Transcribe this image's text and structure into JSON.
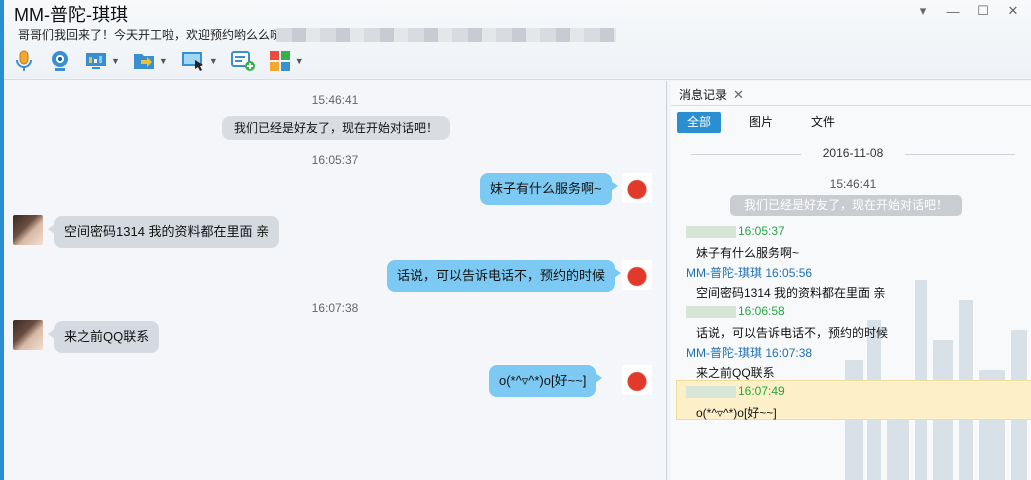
{
  "window": {
    "title": "MM-普陀-琪琪",
    "signature": "哥哥们我回来了！今天开工啦，欢迎预约哟么么哒",
    "controls": {
      "dropdown_icon": "chevron-down-icon",
      "minimize_icon": "minimize-icon",
      "maximize_icon": "maximize-icon",
      "close_icon": "close-icon"
    }
  },
  "toolbar": {
    "items": [
      {
        "name": "voice-call",
        "icon": "microphone-icon"
      },
      {
        "name": "video-call",
        "icon": "webcam-icon"
      },
      {
        "name": "remote-desktop",
        "icon": "monitor-icon"
      },
      {
        "name": "send-file",
        "icon": "folder-icon"
      },
      {
        "name": "screen-share",
        "icon": "screen-share-icon"
      },
      {
        "name": "new-message",
        "icon": "message-plus-icon"
      },
      {
        "name": "apps",
        "icon": "apps-grid-icon"
      }
    ]
  },
  "chat": {
    "timestamps": [
      "15:46:41",
      "16:05:37",
      "16:07:38"
    ],
    "system_message": "我们已经是好友了，现在开始对话吧！",
    "messages": [
      {
        "side": "me",
        "text": "妹子有什么服务啊~"
      },
      {
        "side": "them",
        "text": "空间密码1314  我的资料都在里面  亲"
      },
      {
        "side": "me",
        "text": "话说，可以告诉电话不，预约的时候"
      },
      {
        "side": "them",
        "text": "来之前QQ联系"
      },
      {
        "side": "me",
        "text": "o(*^▿^*)o[好~~]"
      }
    ]
  },
  "history": {
    "tab_label": "消息记录",
    "close_icon": "close-icon",
    "filters": [
      "全部",
      "图片",
      "文件"
    ],
    "active_filter": "全部",
    "date": "2016-11-08",
    "first_time": "15:46:41",
    "system_message": "我们已经是好友了，现在开始对话吧！",
    "entries": [
      {
        "sender": "",
        "time": "16:05:37",
        "text": "妹子有什么服务啊~"
      },
      {
        "sender": "MM-普陀-琪琪",
        "time": "16:05:56",
        "text": "空间密码1314  我的资料都在里面  亲"
      },
      {
        "sender": "",
        "time": "16:06:58",
        "text": "话说，可以告诉电话不，预约的时候"
      },
      {
        "sender": "MM-普陀-琪琪",
        "time": "16:07:38",
        "text": "来之前QQ联系"
      },
      {
        "sender": "",
        "time": "16:07:49",
        "text": "o(*^▿^*)o[好~~]"
      }
    ]
  }
}
